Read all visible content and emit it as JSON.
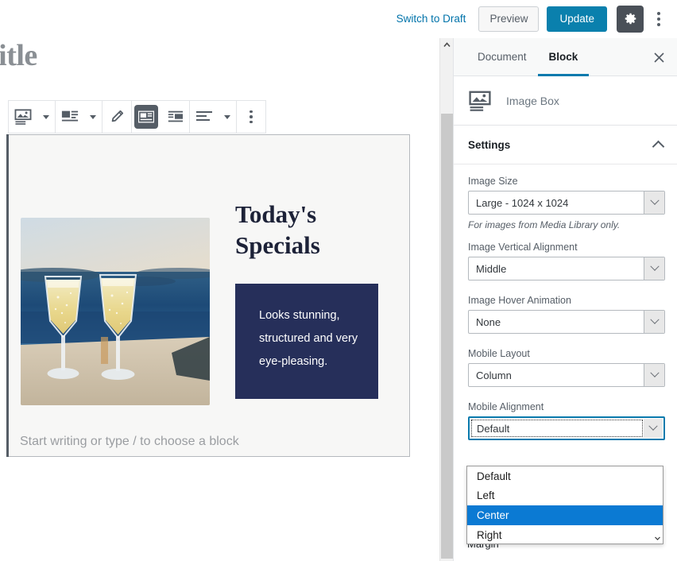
{
  "topbar": {
    "switch_to_draft": "Switch to Draft",
    "preview": "Preview",
    "update": "Update",
    "settings_icon": "gear-icon",
    "more_icon": "kebab-menu-icon"
  },
  "editor": {
    "post_title": "title",
    "empty_paragraph_placeholder": "Start writing or type / to choose a block",
    "toolbar": {
      "block_type_icon": "image-box-icon",
      "layout_icon": "layout-image-left-icon",
      "edit_icon": "pencil-icon",
      "align_image_left_icon": "image-left-icon",
      "align_image_right_icon": "image-right-icon",
      "text_align_icon": "text-align-left-icon",
      "more_icon": "kebab-menu-icon"
    },
    "image_box": {
      "image_alt": "Two champagne flutes on a stone ledge overlooking the sea at sunset",
      "heading": "Today's Specials",
      "description": "Looks stunning, structured and very eye-pleasing.",
      "description_bg": "#262f5a",
      "heading_color": "#1d2238"
    }
  },
  "sidebar": {
    "tabs": [
      {
        "label": "Document",
        "active": false
      },
      {
        "label": "Block",
        "active": true
      }
    ],
    "close_icon": "close-icon",
    "block_card": {
      "icon": "image-box-icon",
      "name": "Image Box"
    },
    "settings_panel": {
      "title": "Settings",
      "collapse_icon": "chevron-up-icon",
      "fields": [
        {
          "label": "Image Size",
          "value": "Large - 1024 x 1024",
          "help": "For images from Media Library only."
        },
        {
          "label": "Image Vertical Alignment",
          "value": "Middle"
        },
        {
          "label": "Image Hover Animation",
          "value": "None"
        },
        {
          "label": "Mobile Layout",
          "value": "Column"
        },
        {
          "label": "Mobile Alignment",
          "value": "Default",
          "open": true,
          "options": [
            "Default",
            "Left",
            "Center",
            "Right"
          ],
          "highlighted_option": "Center"
        }
      ],
      "next_field_label": "Margin"
    }
  },
  "colors": {
    "accent_blue": "#0a80ad",
    "link_blue": "#0073aa",
    "dropdown_highlight": "#0b7ad3",
    "toolbar_dark": "#555d66",
    "gear_button_bg": "#4a5058"
  }
}
